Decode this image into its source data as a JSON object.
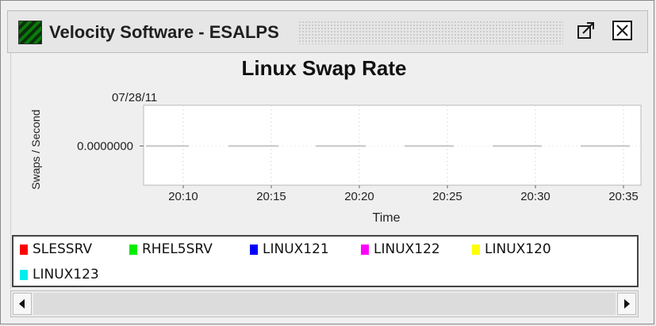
{
  "window": {
    "title": "Velocity Software - ESALPS",
    "icons": [
      "app-icon",
      "popout-icon",
      "close-icon"
    ]
  },
  "chart_data": {
    "type": "line",
    "title": "Linux Swap Rate",
    "date_label": "07/28/11",
    "xlabel": "Time",
    "ylabel": "Swaps / Second",
    "y_tick_labels": [
      "0.0000000"
    ],
    "x_tick_labels": [
      "20:10",
      "20:15",
      "20:20",
      "20:25",
      "20:30",
      "20:35"
    ],
    "grid": true,
    "series": [
      {
        "name": "SLESSRV",
        "color": "#ff0000",
        "values": [
          0,
          0,
          0,
          0,
          0,
          0
        ]
      },
      {
        "name": "RHEL5SRV",
        "color": "#00ee00",
        "values": [
          0,
          0,
          0,
          0,
          0,
          0
        ]
      },
      {
        "name": "LINUX121",
        "color": "#0000ff",
        "values": [
          0,
          0,
          0,
          0,
          0,
          0
        ]
      },
      {
        "name": "LINUX122",
        "color": "#ff00ff",
        "values": [
          0,
          0,
          0,
          0,
          0,
          0
        ]
      },
      {
        "name": "LINUX120",
        "color": "#ffff00",
        "values": [
          0,
          0,
          0,
          0,
          0,
          0
        ]
      },
      {
        "name": "LINUX123",
        "color": "#00eeee",
        "values": [
          0,
          0,
          0,
          0,
          0,
          0
        ]
      }
    ]
  },
  "scrollbar": {
    "left_icon": "arrow-left-icon",
    "right_icon": "arrow-right-icon"
  }
}
